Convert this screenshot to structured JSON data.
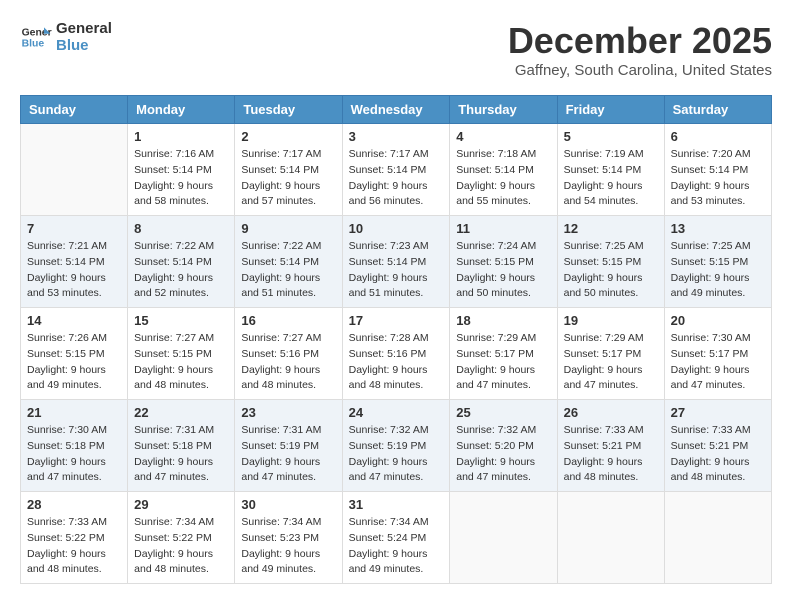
{
  "logo": {
    "line1": "General",
    "line2": "Blue"
  },
  "title": "December 2025",
  "location": "Gaffney, South Carolina, United States",
  "days_header": [
    "Sunday",
    "Monday",
    "Tuesday",
    "Wednesday",
    "Thursday",
    "Friday",
    "Saturday"
  ],
  "weeks": [
    [
      {
        "day": "",
        "info": ""
      },
      {
        "day": "1",
        "info": "Sunrise: 7:16 AM\nSunset: 5:14 PM\nDaylight: 9 hours\nand 58 minutes."
      },
      {
        "day": "2",
        "info": "Sunrise: 7:17 AM\nSunset: 5:14 PM\nDaylight: 9 hours\nand 57 minutes."
      },
      {
        "day": "3",
        "info": "Sunrise: 7:17 AM\nSunset: 5:14 PM\nDaylight: 9 hours\nand 56 minutes."
      },
      {
        "day": "4",
        "info": "Sunrise: 7:18 AM\nSunset: 5:14 PM\nDaylight: 9 hours\nand 55 minutes."
      },
      {
        "day": "5",
        "info": "Sunrise: 7:19 AM\nSunset: 5:14 PM\nDaylight: 9 hours\nand 54 minutes."
      },
      {
        "day": "6",
        "info": "Sunrise: 7:20 AM\nSunset: 5:14 PM\nDaylight: 9 hours\nand 53 minutes."
      }
    ],
    [
      {
        "day": "7",
        "info": "Sunrise: 7:21 AM\nSunset: 5:14 PM\nDaylight: 9 hours\nand 53 minutes."
      },
      {
        "day": "8",
        "info": "Sunrise: 7:22 AM\nSunset: 5:14 PM\nDaylight: 9 hours\nand 52 minutes."
      },
      {
        "day": "9",
        "info": "Sunrise: 7:22 AM\nSunset: 5:14 PM\nDaylight: 9 hours\nand 51 minutes."
      },
      {
        "day": "10",
        "info": "Sunrise: 7:23 AM\nSunset: 5:14 PM\nDaylight: 9 hours\nand 51 minutes."
      },
      {
        "day": "11",
        "info": "Sunrise: 7:24 AM\nSunset: 5:15 PM\nDaylight: 9 hours\nand 50 minutes."
      },
      {
        "day": "12",
        "info": "Sunrise: 7:25 AM\nSunset: 5:15 PM\nDaylight: 9 hours\nand 50 minutes."
      },
      {
        "day": "13",
        "info": "Sunrise: 7:25 AM\nSunset: 5:15 PM\nDaylight: 9 hours\nand 49 minutes."
      }
    ],
    [
      {
        "day": "14",
        "info": "Sunrise: 7:26 AM\nSunset: 5:15 PM\nDaylight: 9 hours\nand 49 minutes."
      },
      {
        "day": "15",
        "info": "Sunrise: 7:27 AM\nSunset: 5:15 PM\nDaylight: 9 hours\nand 48 minutes."
      },
      {
        "day": "16",
        "info": "Sunrise: 7:27 AM\nSunset: 5:16 PM\nDaylight: 9 hours\nand 48 minutes."
      },
      {
        "day": "17",
        "info": "Sunrise: 7:28 AM\nSunset: 5:16 PM\nDaylight: 9 hours\nand 48 minutes."
      },
      {
        "day": "18",
        "info": "Sunrise: 7:29 AM\nSunset: 5:17 PM\nDaylight: 9 hours\nand 47 minutes."
      },
      {
        "day": "19",
        "info": "Sunrise: 7:29 AM\nSunset: 5:17 PM\nDaylight: 9 hours\nand 47 minutes."
      },
      {
        "day": "20",
        "info": "Sunrise: 7:30 AM\nSunset: 5:17 PM\nDaylight: 9 hours\nand 47 minutes."
      }
    ],
    [
      {
        "day": "21",
        "info": "Sunrise: 7:30 AM\nSunset: 5:18 PM\nDaylight: 9 hours\nand 47 minutes."
      },
      {
        "day": "22",
        "info": "Sunrise: 7:31 AM\nSunset: 5:18 PM\nDaylight: 9 hours\nand 47 minutes."
      },
      {
        "day": "23",
        "info": "Sunrise: 7:31 AM\nSunset: 5:19 PM\nDaylight: 9 hours\nand 47 minutes."
      },
      {
        "day": "24",
        "info": "Sunrise: 7:32 AM\nSunset: 5:19 PM\nDaylight: 9 hours\nand 47 minutes."
      },
      {
        "day": "25",
        "info": "Sunrise: 7:32 AM\nSunset: 5:20 PM\nDaylight: 9 hours\nand 47 minutes."
      },
      {
        "day": "26",
        "info": "Sunrise: 7:33 AM\nSunset: 5:21 PM\nDaylight: 9 hours\nand 48 minutes."
      },
      {
        "day": "27",
        "info": "Sunrise: 7:33 AM\nSunset: 5:21 PM\nDaylight: 9 hours\nand 48 minutes."
      }
    ],
    [
      {
        "day": "28",
        "info": "Sunrise: 7:33 AM\nSunset: 5:22 PM\nDaylight: 9 hours\nand 48 minutes."
      },
      {
        "day": "29",
        "info": "Sunrise: 7:34 AM\nSunset: 5:22 PM\nDaylight: 9 hours\nand 48 minutes."
      },
      {
        "day": "30",
        "info": "Sunrise: 7:34 AM\nSunset: 5:23 PM\nDaylight: 9 hours\nand 49 minutes."
      },
      {
        "day": "31",
        "info": "Sunrise: 7:34 AM\nSunset: 5:24 PM\nDaylight: 9 hours\nand 49 minutes."
      },
      {
        "day": "",
        "info": ""
      },
      {
        "day": "",
        "info": ""
      },
      {
        "day": "",
        "info": ""
      }
    ]
  ]
}
